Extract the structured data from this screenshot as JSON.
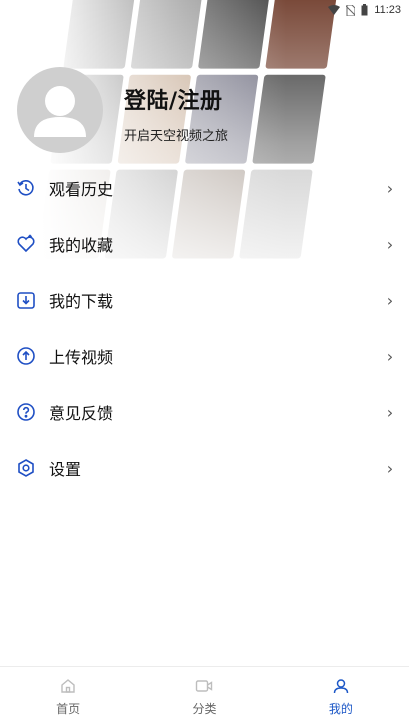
{
  "status_bar": {
    "time": "11:23",
    "icons": [
      "wifi-icon",
      "no-sim-icon",
      "battery-icon"
    ]
  },
  "profile": {
    "title": "登陆/注册",
    "subtitle": "开启天空视频之旅",
    "avatar_icon": "default-user-icon"
  },
  "menu": [
    {
      "label": "观看历史",
      "icon": "history-icon"
    },
    {
      "label": "我的收藏",
      "icon": "heart-icon"
    },
    {
      "label": "我的下载",
      "icon": "download-icon"
    },
    {
      "label": "上传视频",
      "icon": "upload-icon"
    },
    {
      "label": "意见反馈",
      "icon": "question-icon"
    },
    {
      "label": "设置",
      "icon": "settings-icon"
    }
  ],
  "bottom_nav": [
    {
      "label": "首页",
      "icon": "home-icon",
      "active": false
    },
    {
      "label": "分类",
      "icon": "category-icon",
      "active": false
    },
    {
      "label": "我的",
      "icon": "user-icon",
      "active": true
    }
  ],
  "colors": {
    "accent": "#1d58c7",
    "icon_blue": "#1f4fc4",
    "muted": "#bdbdbd"
  }
}
